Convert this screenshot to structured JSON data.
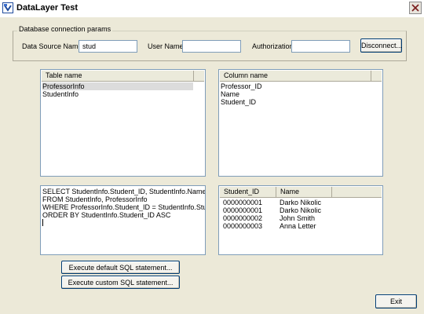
{
  "window": {
    "title": "DataLayer Test"
  },
  "connection": {
    "group_label": "Database connection params",
    "data_source_label": "Data Source Name:",
    "data_source_value": "stud",
    "user_label": "User Name:",
    "user_value": "",
    "auth_label": "Authorization:",
    "auth_value": "",
    "disconnect_label": "Disconnect..."
  },
  "tables_list": {
    "header": "Table name",
    "items": [
      "ProfessorInfo",
      "StudentInfo"
    ],
    "selected_index": 0
  },
  "columns_list": {
    "header": "Column name",
    "items": [
      "Professor_ID",
      "Name",
      "Student_ID"
    ]
  },
  "sql": {
    "lines": [
      "SELECT StudentInfo.Student_ID, StudentInfo.Name",
      "FROM StudentInfo, ProfessorInfo",
      "WHERE ProfessorInfo.Student_ID = StudentInfo.Student_ID",
      "ORDER BY StudentInfo.Student_ID ASC"
    ]
  },
  "results": {
    "columns": [
      "Student_ID",
      "Name"
    ],
    "rows": [
      [
        "0000000001",
        "Darko Nikolic"
      ],
      [
        "0000000001",
        "Darko Nikolic"
      ],
      [
        "0000000002",
        "John Smith"
      ],
      [
        "0000000003",
        "Anna Letter"
      ]
    ]
  },
  "buttons": {
    "execute_default": "Execute default SQL statement...",
    "execute_custom": "Execute custom SQL statement...",
    "exit": "Exit"
  }
}
